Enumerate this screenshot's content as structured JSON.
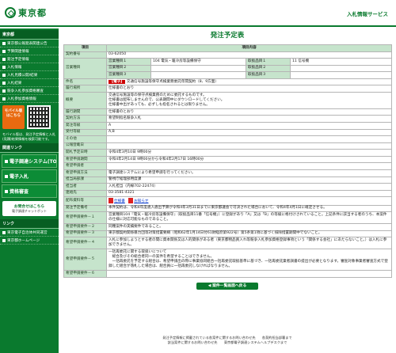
{
  "header": {
    "logo_text": "東京都",
    "service_title": "入札情報サービス"
  },
  "sidebar": {
    "section1": "東京都",
    "items1": [
      "東京都公報発表関連公告",
      "予算関連情報",
      "発注予定情報",
      "入札情報",
      "入札見積公開/結果",
      "入札結果",
      "競争入札参加資格審査",
      "入札参加資格情報"
    ],
    "mobile_badge": "モバイル版 はこちら",
    "mobile_note": "モバイル版は、発注予定情報と入札(見積)結果情報を検索可能です。",
    "section2": "関連リンク",
    "big_items": [
      "電子調達システム(TOP)",
      "電子入札",
      "資格審査"
    ],
    "chart_link_l1": "お問合せはこちら",
    "chart_link_l2": "電子調達チャットボット",
    "section3": "リンク",
    "items3": [
      "東京電子自治体共同運営",
      "東京都ホームページ"
    ]
  },
  "main": {
    "title": "発注予定表",
    "col_item": "項目",
    "col_content": "項目内容",
    "rows": {
      "contract_no": {
        "label": "契約番号",
        "value": "03-62050"
      },
      "business_type": {
        "label": "営業種目",
        "v1_label": "営業種目１",
        "v1": "104 電気・暖冷房等設備保守",
        "v2_label": "営業種目２",
        "v3_label": "営業種目３",
        "s1_label": "取扱品目１",
        "s1": "11 信号機",
        "s2_label": "取扱品目２",
        "s3_label": "取扱品目３"
      },
      "name": {
        "label": "件名",
        "tag": "【電子】",
        "value": "交通信号施設等保守点検業務委託年間契約（8、9方面）"
      },
      "location": {
        "label": "履行場所",
        "value": "仕様書のとおり"
      },
      "summary": {
        "label": "概要",
        "lines": [
          "交通信号施設等の保守点検業務のために委託するものです。",
          "仕様書は配布しませんので、公表期間中にダウンロードしてください。",
          "仕様書中出があっても、必ずしも指名されるとは限りません。"
        ]
      },
      "period": {
        "label": "履行期間",
        "value": "仕様書のとおり"
      },
      "method": {
        "label": "契約方法",
        "value": "希望制指名競争入札"
      },
      "order_type": {
        "label": "発注等級",
        "value": "A"
      },
      "accept_type": {
        "label": "受付等級",
        "value": "A,B"
      },
      "other": {
        "label": "その他",
        "value": ""
      },
      "announce_date": {
        "label": "公報登載日",
        "value": ""
      },
      "open_date": {
        "label": "開札予定日時",
        "value": "令和4年3月10日 9時00分"
      },
      "apply_period": {
        "label": "希望申請期間",
        "value": "令和4年2月14日 9時00分から令和4年2月17日 16時00分"
      },
      "apply_notes": {
        "label": "希望申請者",
        "value": ""
      },
      "apply_method": {
        "label": "希望申請方法",
        "value": "電子調達システムにより希望申請を行ってください。"
      },
      "dept": {
        "label": "担当局部課",
        "value": "警視庁経理部用度課"
      },
      "person": {
        "label": "担当者",
        "value": "入札担当（内線702-22474）"
      },
      "contact": {
        "label": "連絡先",
        "value": "03-3581-4321"
      },
      "attachments": {
        "label": "配布資料等",
        "file1": "仕様書",
        "file2": "お知らせ"
      },
      "schedule": {
        "label": "発注予定備考",
        "value": "本件契約は、令和4年度歳入歳出予算が令和4年3月31日までに東京都議会で可決された場合において、令和4年4月1日に確定させる。"
      },
      "req1": {
        "label": "希望申請要件－１",
        "value": "営業種目104『電気・暖冷房等設備保守』（取扱品目11番「信号機」）に登録があり「A」又は「B」の等級に格付けされていること。上記条件に該当する者のうち、本案件の仕様に対応可能なものであること。"
      },
      "req2": {
        "label": "希望申請要件－２",
        "value": "同種案件の実績要件であること。"
      },
      "req3": {
        "label": "希望申請要件－３",
        "value": "東京都契約関係暴力団等対策措置要綱（昭和62年1月14日付61財経庶第922号）第5条第1項に基づく排除措置期間中でないこと。"
      },
      "req4": {
        "label": "希望申請要件－４",
        "value": "入札に参加しようとする者の間に資本関係又は人的関係がある者（東京都物品買入れ等競争入札参加資格登録事項という「関係する会社」にあたらないこと。）は入札に参加できません。"
      },
      "req5": {
        "label": "希望申請要件－５",
        "lines": [
          "一括再委託に関する取扱いについて",
          "　総合及びその総合者同一の案件を希望することはできません。",
          "　一括再委託を予定する組合は、希望申請出の際に事業協同組合一括再委託取扱基準に基づき、一括再委託業者調書の提出が必要となります。審査対象事業者審査方式で登録した組合が落札した場合は、組合員に一括再委託しなければなりません。"
        ]
      },
      "req6": {
        "label": "希望申請要件－６",
        "value": ""
      }
    },
    "back_button": "案件一覧画面へ戻る"
  },
  "footer": {
    "line1": "発注予定情報に掲載されている各案件に関するお問い合わせ先　　各契約担当部署まで",
    "line2": "該当案件に関するお問い合わせ先　　東京都電子調達システムヘルプデスクまで"
  }
}
